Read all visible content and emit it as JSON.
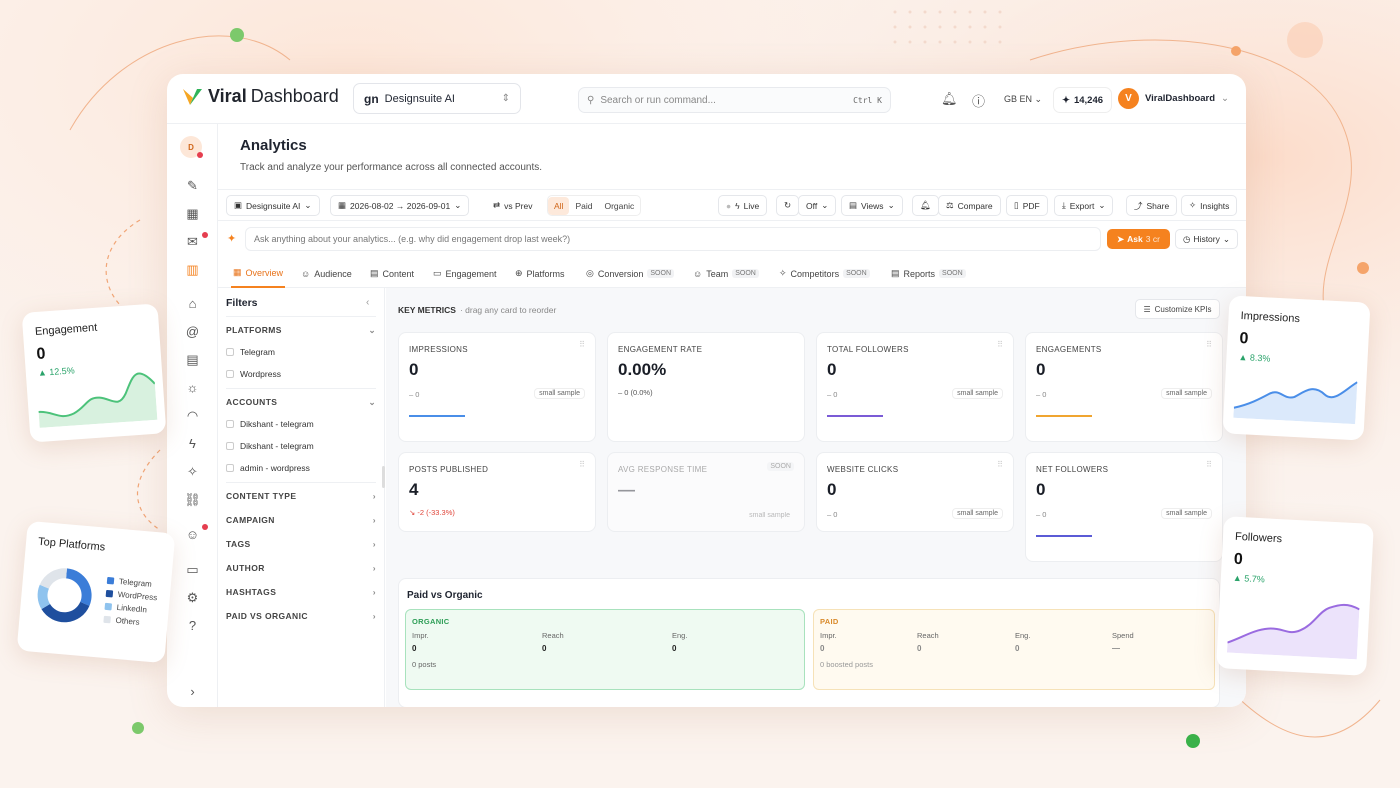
{
  "brand": {
    "viral": "Viral",
    "dashboard": "Dashboard",
    "accent": "#f5821f"
  },
  "workspace": {
    "mark": "gn",
    "name": "Designsuite AI"
  },
  "search": {
    "placeholder": "Search or run command...",
    "shortcut": "Ctrl K"
  },
  "header": {
    "lang": "GB EN",
    "credits": "14,246",
    "user_initial": "V",
    "user_name": "ViralDashboard"
  },
  "rail": {
    "avatar": "D"
  },
  "page": {
    "title": "Analytics",
    "subtitle": "Track and analyze your performance across all connected accounts."
  },
  "toolbar": {
    "workspace": "Designsuite AI",
    "date_range": "2026-08-02 → 2026-09-01",
    "compare": "vs Prev",
    "segments": [
      "All",
      "Paid",
      "Organic"
    ],
    "live": "Live",
    "off": "Off",
    "views": "Views",
    "compare_btn": "Compare",
    "pdf": "PDF",
    "export": "Export",
    "share": "Share",
    "insights": "Insights"
  },
  "ask": {
    "placeholder": "Ask anything about your analytics... (e.g. why did engagement drop last week?)",
    "button": "Ask",
    "cost": "3 cr",
    "history": "History"
  },
  "tabs": [
    {
      "label": "Overview",
      "soon": ""
    },
    {
      "label": "Audience",
      "soon": ""
    },
    {
      "label": "Content",
      "soon": ""
    },
    {
      "label": "Engagement",
      "soon": ""
    },
    {
      "label": "Platforms",
      "soon": ""
    },
    {
      "label": "Conversion",
      "soon": "SOON"
    },
    {
      "label": "Team",
      "soon": "SOON"
    },
    {
      "label": "Competitors",
      "soon": "SOON"
    },
    {
      "label": "Reports",
      "soon": "SOON"
    }
  ],
  "filters": {
    "title": "Filters",
    "platforms_label": "PLATFORMS",
    "platforms": [
      "Telegram",
      "Wordpress"
    ],
    "accounts_label": "ACCOUNTS",
    "accounts": [
      "Dikshant - telegram",
      "Dikshant - telegram",
      "admin - wordpress"
    ],
    "sections": [
      "CONTENT TYPE",
      "CAMPAIGN",
      "TAGS",
      "AUTHOR",
      "HASHTAGS",
      "PAID VS ORGANIC"
    ]
  },
  "metrics": {
    "title": "KEY METRICS",
    "hint": "· drag any card to reorder",
    "customize": "Customize KPIs",
    "cards": [
      {
        "label": "IMPRESSIONS",
        "value": "0",
        "delta": "– 0",
        "badge": "small sample",
        "color": "#4a8ee8"
      },
      {
        "label": "ENGAGEMENT RATE",
        "value": "0.00%",
        "delta": "– 0 (0.0%)",
        "badge": "",
        "color": ""
      },
      {
        "label": "TOTAL FOLLOWERS",
        "value": "0",
        "delta": "– 0",
        "badge": "small sample",
        "color": "#7b5bd6"
      },
      {
        "label": "ENGAGEMENTS",
        "value": "0",
        "delta": "– 0",
        "badge": "small sample",
        "color": "#f0a530"
      },
      {
        "label": "POSTS PUBLISHED",
        "value": "4",
        "delta": "↘ -2 (-33.3%)",
        "badge": "",
        "color": ""
      },
      {
        "label": "AVG RESPONSE TIME",
        "value": "—",
        "delta": "",
        "badge": "small sample",
        "soon": "SOON",
        "color": ""
      },
      {
        "label": "WEBSITE CLICKS",
        "value": "0",
        "delta": "– 0",
        "badge": "small sample",
        "color": ""
      },
      {
        "label": "NET FOLLOWERS",
        "value": "0",
        "delta": "– 0",
        "badge": "small sample",
        "color": "#5b5bd6"
      }
    ]
  },
  "paid_vs_organic": {
    "title": "Paid vs Organic",
    "organic": {
      "label": "ORGANIC",
      "cols": [
        "Impr.",
        "Reach",
        "Eng."
      ],
      "values": [
        "0",
        "0",
        "0"
      ],
      "posts": "0 posts"
    },
    "paid": {
      "label": "PAID",
      "cols": [
        "Impr.",
        "Reach",
        "Eng.",
        "Spend"
      ],
      "values": [
        "0",
        "0",
        "0",
        "—"
      ],
      "posts": "0 boosted posts"
    }
  },
  "float_cards": {
    "engagement": {
      "title": "Engagement",
      "value": "0",
      "pct": "▲ 12.5%"
    },
    "impressions": {
      "title": "Impressions",
      "value": "0",
      "pct": "▲ 8.3%"
    },
    "followers": {
      "title": "Followers",
      "value": "0",
      "pct": "▲ 5.7%"
    },
    "platforms": {
      "title": "Top Platforms",
      "items": [
        "Telegram",
        "WordPress",
        "LinkedIn",
        "Others"
      ],
      "shares": [
        30,
        35,
        15,
        20
      ],
      "colors": [
        "#3b7dd8",
        "#1f4f9e",
        "#8fc3ee",
        "#dfe4ea"
      ]
    }
  }
}
